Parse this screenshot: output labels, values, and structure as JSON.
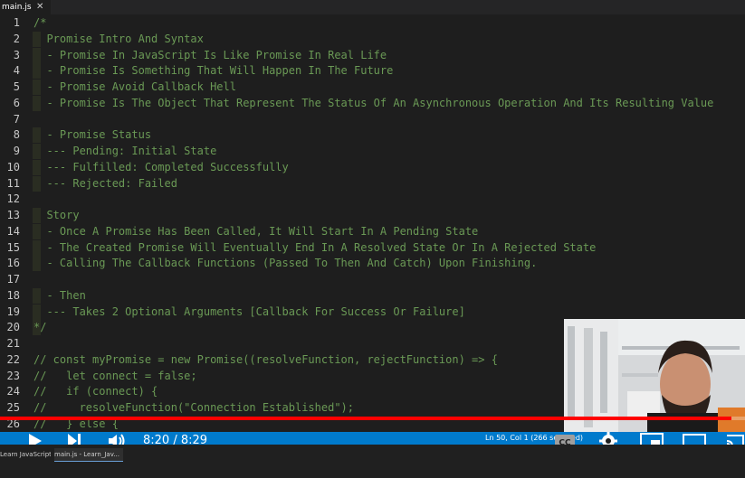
{
  "tab": {
    "label": "main.js",
    "close": "✕"
  },
  "editor": {
    "lines": [
      {
        "num": "1",
        "text": "/*"
      },
      {
        "num": "2",
        "text": "  Promise Intro And Syntax"
      },
      {
        "num": "3",
        "text": "  - Promise In JavaScript Is Like Promise In Real Life"
      },
      {
        "num": "4",
        "text": "  - Promise Is Something That Will Happen In The Future"
      },
      {
        "num": "5",
        "text": "  - Promise Avoid Callback Hell"
      },
      {
        "num": "6",
        "text": "  - Promise Is The Object That Represent The Status Of An Asynchronous Operation And Its Resulting Value"
      },
      {
        "num": "7",
        "text": ""
      },
      {
        "num": "8",
        "text": "  - Promise Status"
      },
      {
        "num": "9",
        "text": "  --- Pending: Initial State"
      },
      {
        "num": "10",
        "text": "  --- Fulfilled: Completed Successfully"
      },
      {
        "num": "11",
        "text": "  --- Rejected: Failed"
      },
      {
        "num": "12",
        "text": ""
      },
      {
        "num": "13",
        "text": "  Story"
      },
      {
        "num": "14",
        "text": "  - Once A Promise Has Been Called, It Will Start In A Pending State"
      },
      {
        "num": "15",
        "text": "  - The Created Promise Will Eventually End In A Resolved State Or In A Rejected State"
      },
      {
        "num": "16",
        "text": "  - Calling The Callback Functions (Passed To Then And Catch) Upon Finishing."
      },
      {
        "num": "17",
        "text": ""
      },
      {
        "num": "18",
        "text": "  - Then"
      },
      {
        "num": "19",
        "text": "  --- Takes 2 Optional Arguments [Callback For Success Or Failure]"
      },
      {
        "num": "20",
        "text": "*/"
      },
      {
        "num": "21",
        "text": ""
      },
      {
        "num": "22",
        "text": "// const myPromise = new Promise((resolveFunction, rejectFunction) => {"
      },
      {
        "num": "23",
        "text": "//   let connect = false;"
      },
      {
        "num": "24",
        "text": "//   if (connect) {"
      },
      {
        "num": "25",
        "text": "//     resolveFunction(\"Connection Established\");"
      },
      {
        "num": "26",
        "text": "//   } else {"
      }
    ]
  },
  "status_bar": {
    "text": "Ln 50, Col 1 (266 selected)"
  },
  "player": {
    "time": "8:20 / 8:29",
    "progress": 0.982,
    "colors": {
      "progress": "#ff0000",
      "status_bar": "#007acc"
    }
  },
  "taskbar": {
    "items": [
      {
        "label": "Learn JavaScript - G..."
      },
      {
        "label": "main.js - Learn_Jav..."
      }
    ]
  },
  "icons": {
    "play": "play-icon",
    "next": "next-icon",
    "volume": "volume-icon",
    "cc": "cc-icon",
    "settings": "gear-icon",
    "miniplayer": "miniplayer-icon",
    "theater": "theater-icon",
    "cast": "cast-icon"
  }
}
